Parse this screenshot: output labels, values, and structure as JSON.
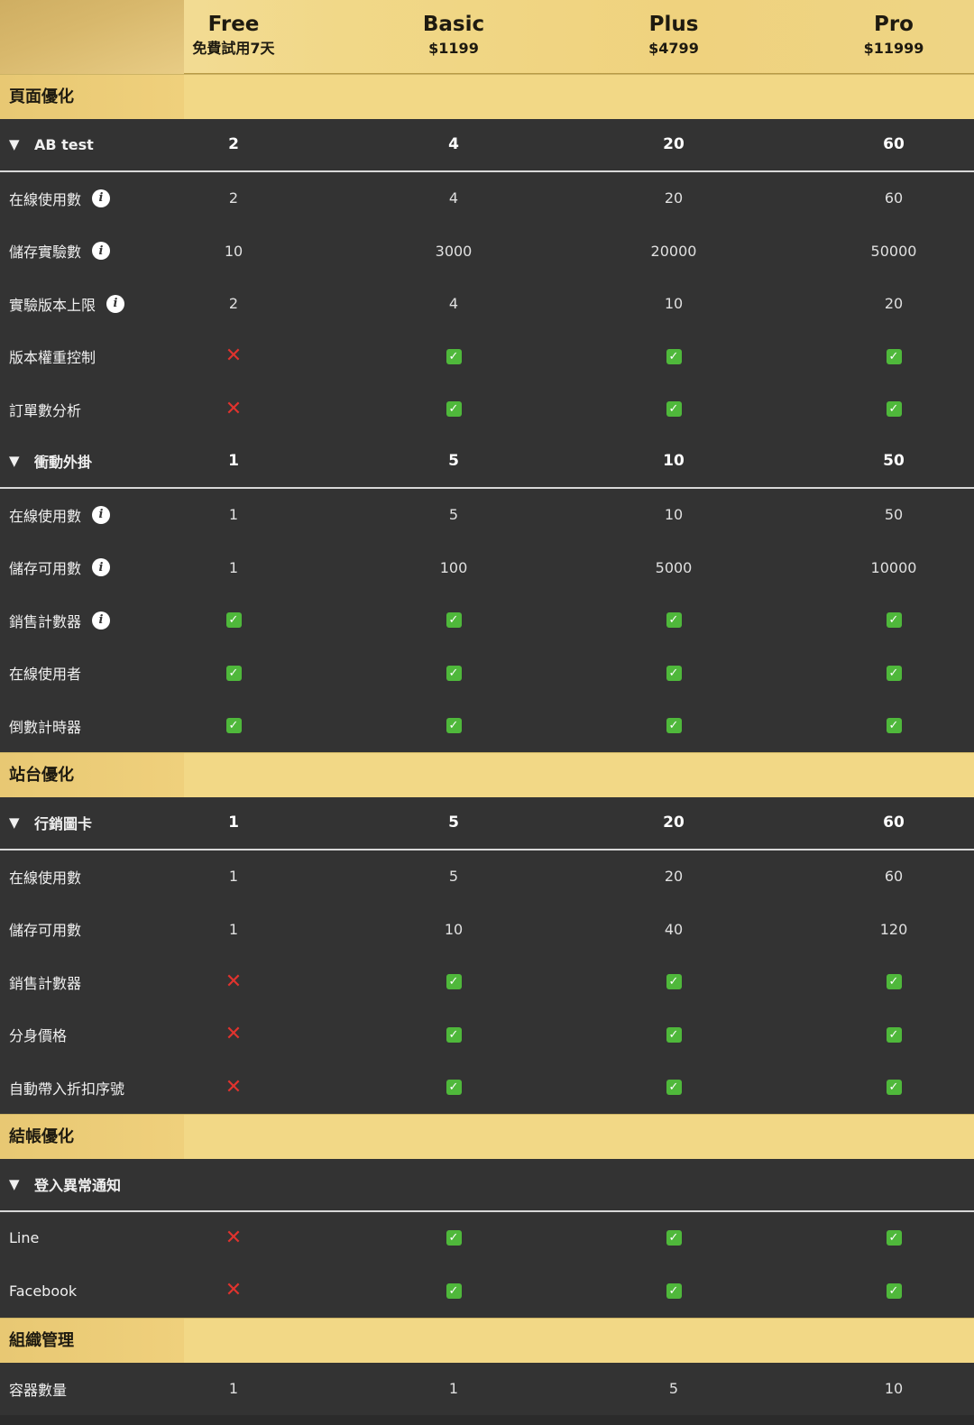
{
  "plans": [
    {
      "name": "Free",
      "price": "免費試用7天"
    },
    {
      "name": "Basic",
      "price": "$1199"
    },
    {
      "name": "Plus",
      "price": "$4799"
    },
    {
      "name": "Pro",
      "price": "$11999"
    }
  ],
  "colors": {
    "check": "#4fb83b",
    "cross": "#e0332e",
    "section": "#f2d886",
    "row": "#333333"
  },
  "rows": [
    {
      "type": "section",
      "label": "頁面優化"
    },
    {
      "type": "group",
      "label": "AB test",
      "values": [
        "2",
        "4",
        "20",
        "60"
      ]
    },
    {
      "type": "item",
      "label": "在線使用數",
      "info": true,
      "values": [
        "2",
        "4",
        "20",
        "60"
      ]
    },
    {
      "type": "item",
      "label": "儲存實驗數",
      "info": true,
      "values": [
        "10",
        "3000",
        "20000",
        "50000"
      ]
    },
    {
      "type": "item",
      "label": "實驗版本上限",
      "info": true,
      "values": [
        "2",
        "4",
        "10",
        "20"
      ]
    },
    {
      "type": "item",
      "label": "版本權重控制",
      "values": [
        "cross",
        "check",
        "check",
        "check"
      ]
    },
    {
      "type": "item",
      "label": "訂單數分析",
      "values": [
        "cross",
        "check",
        "check",
        "check"
      ]
    },
    {
      "type": "group",
      "label": "衝動外掛",
      "values": [
        "1",
        "5",
        "10",
        "50"
      ]
    },
    {
      "type": "item",
      "label": "在線使用數",
      "info": true,
      "values": [
        "1",
        "5",
        "10",
        "50"
      ]
    },
    {
      "type": "item",
      "label": "儲存可用數",
      "info": true,
      "values": [
        "1",
        "100",
        "5000",
        "10000"
      ]
    },
    {
      "type": "item",
      "label": "銷售計數器",
      "info": true,
      "values": [
        "check",
        "check",
        "check",
        "check"
      ]
    },
    {
      "type": "item",
      "label": "在線使用者",
      "values": [
        "check",
        "check",
        "check",
        "check"
      ]
    },
    {
      "type": "item",
      "label": "倒數計時器",
      "values": [
        "check",
        "check",
        "check",
        "check"
      ]
    },
    {
      "type": "section",
      "label": "站台優化"
    },
    {
      "type": "group",
      "label": "行銷圖卡",
      "values": [
        "1",
        "5",
        "20",
        "60"
      ]
    },
    {
      "type": "item",
      "label": "在線使用數",
      "values": [
        "1",
        "5",
        "20",
        "60"
      ]
    },
    {
      "type": "item",
      "label": "儲存可用數",
      "values": [
        "1",
        "10",
        "40",
        "120"
      ]
    },
    {
      "type": "item",
      "label": "銷售計數器",
      "values": [
        "cross",
        "check",
        "check",
        "check"
      ]
    },
    {
      "type": "item",
      "label": "分身價格",
      "values": [
        "cross",
        "check",
        "check",
        "check"
      ]
    },
    {
      "type": "item",
      "label": "自動帶入折扣序號",
      "values": [
        "cross",
        "check",
        "check",
        "check"
      ]
    },
    {
      "type": "section",
      "label": "結帳優化"
    },
    {
      "type": "group",
      "label": "登入異常通知",
      "values": [
        "",
        "",
        "",
        ""
      ]
    },
    {
      "type": "item",
      "label": "Line",
      "values": [
        "cross",
        "check",
        "check",
        "check"
      ]
    },
    {
      "type": "item",
      "label": "Facebook",
      "values": [
        "cross",
        "check",
        "check",
        "check"
      ]
    },
    {
      "type": "section",
      "label": "組織管理"
    },
    {
      "type": "item",
      "label": "容器數量",
      "values": [
        "1",
        "1",
        "5",
        "10"
      ]
    }
  ]
}
